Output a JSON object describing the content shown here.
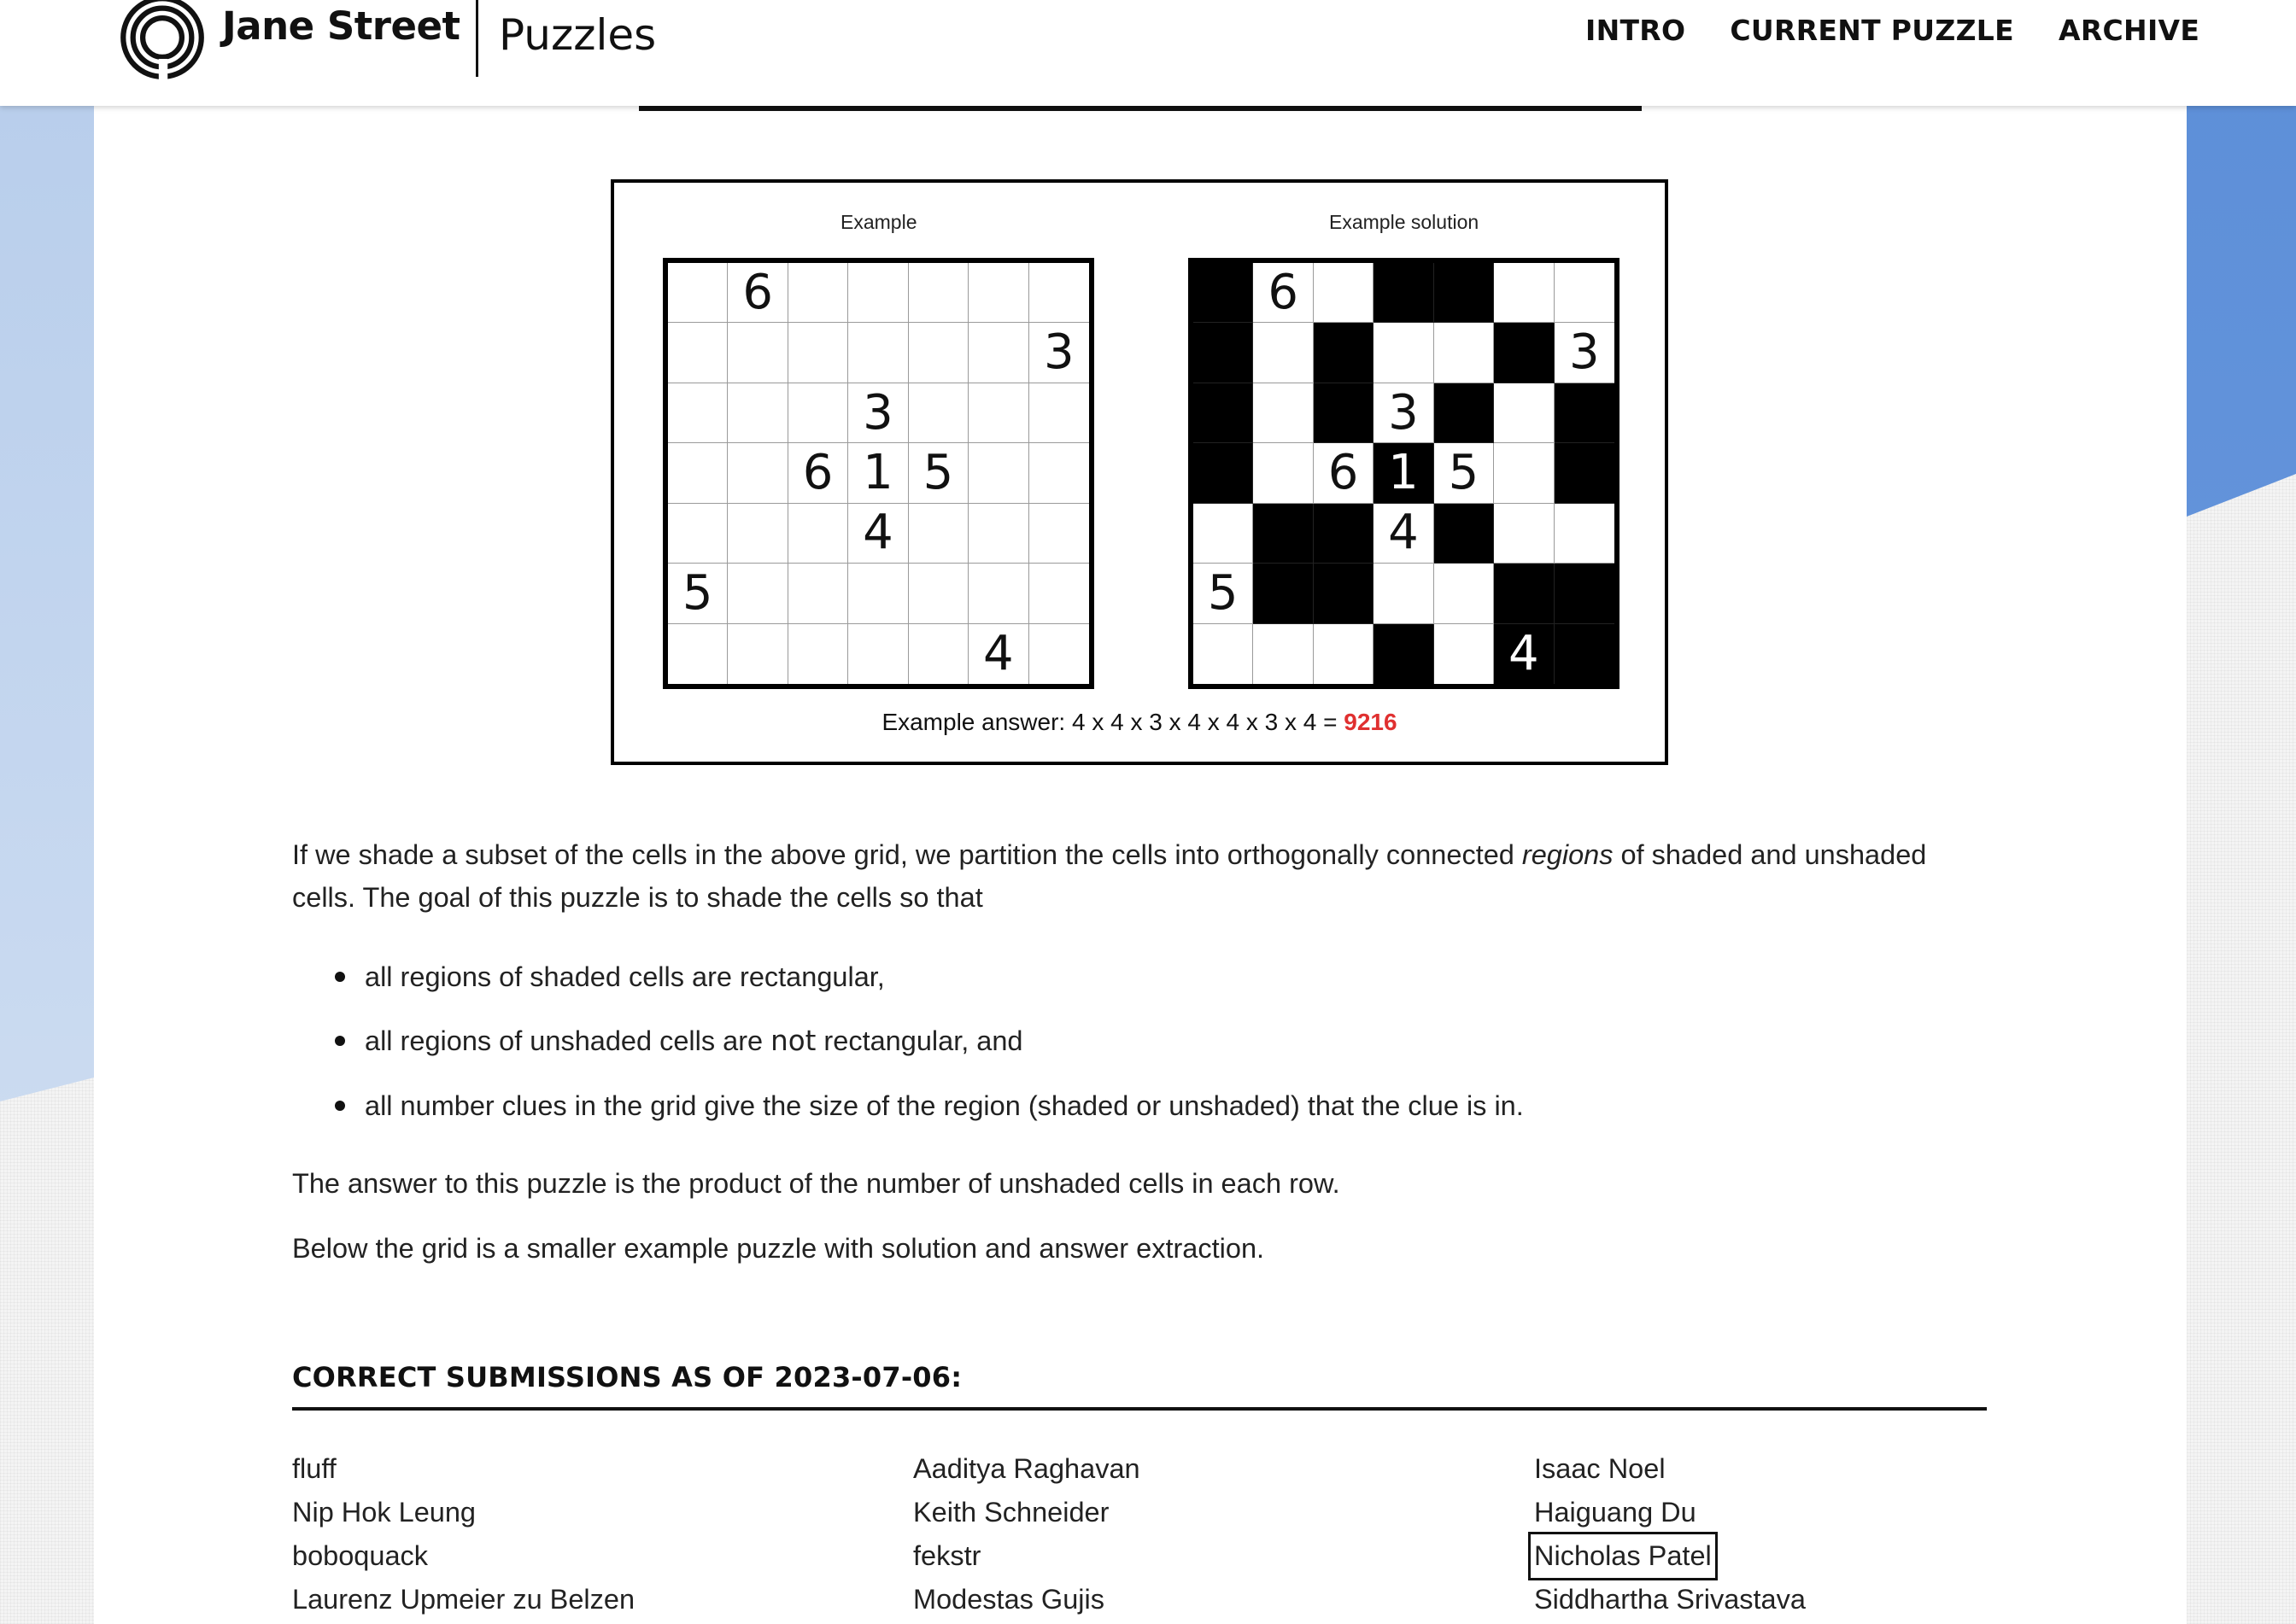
{
  "header": {
    "brand": "Jane Street",
    "section": "Puzzles",
    "nav": [
      "INTRO",
      "CURRENT PUZZLE",
      "ARCHIVE"
    ]
  },
  "figure": {
    "left_title": "Example",
    "right_title": "Example solution",
    "example_grid": [
      [
        "",
        "6",
        "",
        "",
        "",
        "",
        ""
      ],
      [
        "",
        "",
        "",
        "",
        "",
        "",
        "3"
      ],
      [
        "",
        "",
        "",
        "3",
        "",
        "",
        ""
      ],
      [
        "",
        "",
        "6",
        "1",
        "5",
        "",
        ""
      ],
      [
        "",
        "",
        "",
        "4",
        "",
        "",
        ""
      ],
      [
        "5",
        "",
        "",
        "",
        "",
        "",
        ""
      ],
      [
        "",
        "",
        "",
        "",
        "",
        "4",
        ""
      ]
    ],
    "solution_shading": [
      [
        1,
        0,
        0,
        1,
        1,
        0,
        0
      ],
      [
        1,
        0,
        1,
        0,
        0,
        1,
        0
      ],
      [
        1,
        0,
        1,
        0,
        1,
        0,
        1
      ],
      [
        1,
        0,
        0,
        1,
        0,
        0,
        1
      ],
      [
        0,
        1,
        1,
        0,
        1,
        0,
        0
      ],
      [
        0,
        1,
        1,
        0,
        0,
        1,
        1
      ],
      [
        0,
        0,
        0,
        1,
        0,
        1,
        1
      ]
    ],
    "answer_label": "Example answer: 4 x 4 x 3 x 4 x 4 x 3 x 4 = ",
    "answer_value": "9216"
  },
  "content": {
    "para1_a": "If we shade a subset of the cells in the above grid, we partition the cells into orthogonally connected ",
    "para1_em": "regions",
    "para1_b": " of shaded and unshaded cells. The goal of this puzzle is to shade the cells so that",
    "bullet1": "all regions of shaded cells are rectangular,",
    "bullet2_a": "all regions of unshaded cells are ",
    "bullet2_not": "not",
    "bullet2_b": " rectangular, and",
    "bullet3": "all number clues in the grid give the size of the region (shaded or unshaded) that the clue is in.",
    "para2": "The answer to this puzzle is the product of the number of unshaded cells in each row.",
    "para3": "Below the grid is a smaller example puzzle with solution and answer extraction."
  },
  "submissions": {
    "heading": "CORRECT SUBMISSIONS AS OF 2023-07-06:",
    "columns": [
      [
        "fluff",
        "Nip Hok Leung",
        "boboquack",
        "Laurenz Upmeier zu Belzen"
      ],
      [
        "Aaditya Raghavan",
        "Keith Schneider",
        "fekstr",
        "Modestas Gujis"
      ],
      [
        "Isaac Noel",
        "Haiguang Du",
        "Nicholas Patel",
        "Siddhartha Srivastava"
      ]
    ],
    "highlighted": "Nicholas Patel"
  },
  "colors": {
    "accent_red": "#e03030",
    "bg_left_blue": "#b7cdeb",
    "bg_right_blue": "#5d8fd8"
  }
}
